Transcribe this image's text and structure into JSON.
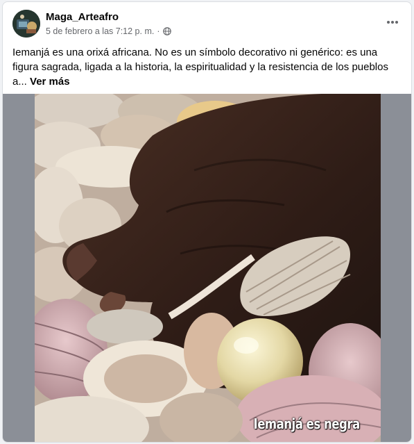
{
  "post": {
    "author": "Maga_Arteafro",
    "timestamp": "5 de febrero a las 7:12 p. m.",
    "separator": "·",
    "privacy_icon": "globe-icon",
    "more_icon": "more-horizontal-icon",
    "text": "Iemanjá es una orixá africana. No es un símbolo decorativo ni genérico: es una figura sagrada, ligada a la historia, la espiritualidad y la resistencia de los pueblos a...",
    "see_more": "Ver más"
  },
  "media": {
    "caption": "Iemanjá es negra",
    "description_icon": "photo-hand-on-seashells"
  },
  "colors": {
    "background": "#f0f2f5",
    "card": "#ffffff",
    "text_primary": "#050505",
    "text_secondary": "#65676b",
    "media_backdrop": "#8b8f97"
  }
}
